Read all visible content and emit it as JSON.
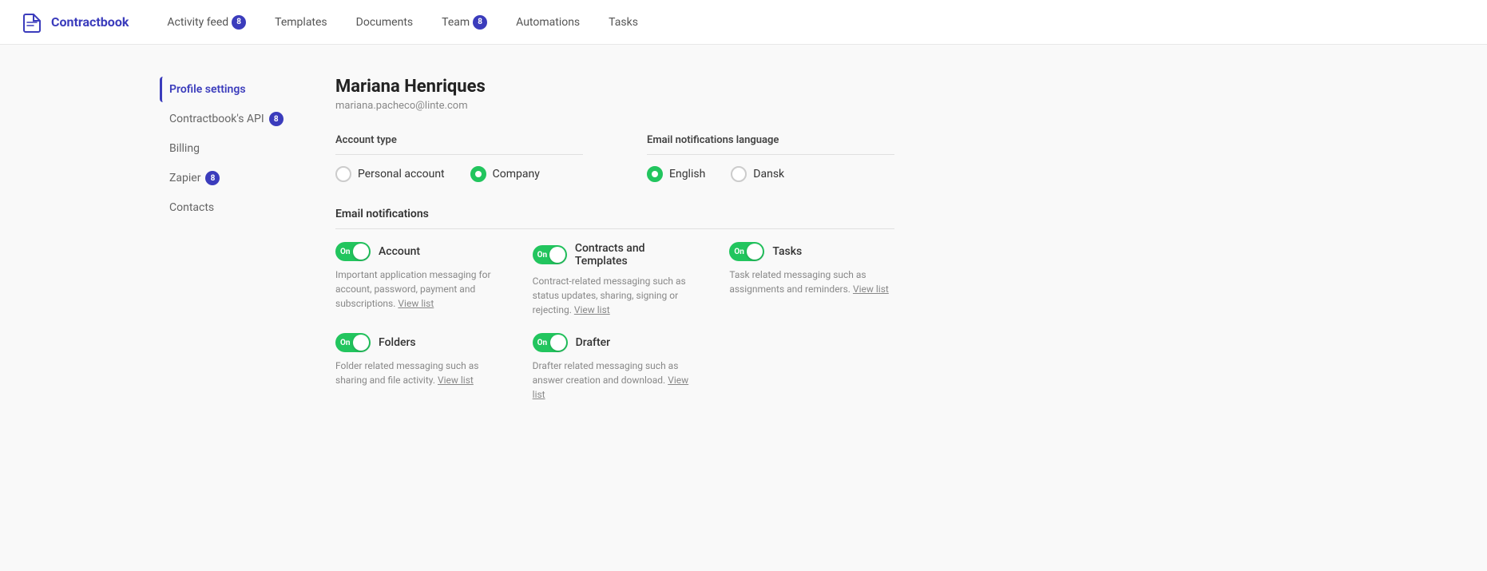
{
  "logo": {
    "text": "Contractbook"
  },
  "nav": {
    "items": [
      {
        "label": "Activity feed",
        "badge": "8",
        "hasBadge": true
      },
      {
        "label": "Templates",
        "hasBadge": false
      },
      {
        "label": "Documents",
        "hasBadge": false
      },
      {
        "label": "Team",
        "badge": "8",
        "hasBadge": true
      },
      {
        "label": "Automations",
        "hasBadge": false
      },
      {
        "label": "Tasks",
        "hasBadge": false
      }
    ]
  },
  "sidebar": {
    "items": [
      {
        "label": "Profile settings",
        "active": true,
        "hasBadge": false
      },
      {
        "label": "Contractbook's API",
        "hasBadge": true,
        "badge": "8"
      },
      {
        "label": "Billing",
        "hasBadge": false
      },
      {
        "label": "Zapier",
        "hasBadge": true,
        "badge": "8"
      },
      {
        "label": "Contacts",
        "hasBadge": false
      }
    ]
  },
  "profile": {
    "name": "Mariana Henriques",
    "email": "mariana.pacheco@linte.com"
  },
  "accountType": {
    "label": "Account type",
    "options": [
      {
        "label": "Personal account",
        "selected": false
      },
      {
        "label": "Company",
        "selected": true
      }
    ]
  },
  "emailLanguage": {
    "label": "Email notifications language",
    "options": [
      {
        "label": "English",
        "selected": true
      },
      {
        "label": "Dansk",
        "selected": false
      }
    ]
  },
  "emailNotifications": {
    "label": "Email notifications",
    "items": [
      {
        "name": "Account",
        "toggleOn": true,
        "toggleLabel": "On",
        "description": "Important application messaging for account, password, payment and subscriptions.",
        "linkText": "View list"
      },
      {
        "name": "Contracts and Templates",
        "toggleOn": true,
        "toggleLabel": "On",
        "description": "Contract-related messaging such as status updates, sharing, signing or rejecting.",
        "linkText": "View list"
      },
      {
        "name": "Tasks",
        "toggleOn": true,
        "toggleLabel": "On",
        "description": "Task related messaging such as assignments and reminders.",
        "linkText": "View list"
      },
      {
        "name": "Folders",
        "toggleOn": true,
        "toggleLabel": "On",
        "description": "Folder related messaging such as sharing and file activity.",
        "linkText": "View list"
      },
      {
        "name": "Drafter",
        "toggleOn": true,
        "toggleLabel": "On",
        "description": "Drafter related messaging such as answer creation and download.",
        "linkText": "View list"
      }
    ]
  }
}
